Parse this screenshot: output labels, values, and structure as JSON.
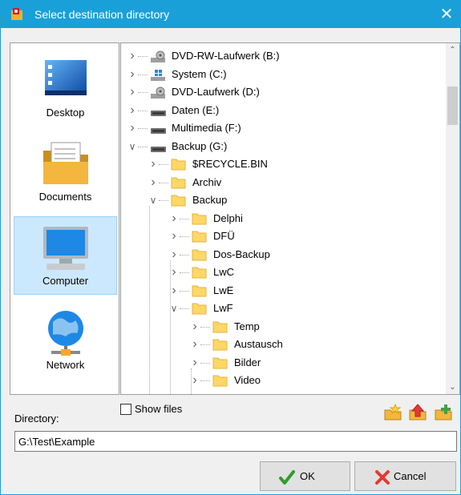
{
  "window": {
    "title": "Select destination directory",
    "titlebar_color": "#1aa0d8",
    "close_label": "✕"
  },
  "places": [
    {
      "label": "Desktop",
      "icon": "desktop-icon",
      "selected": false
    },
    {
      "label": "Documents",
      "icon": "documents-folder-icon",
      "selected": false
    },
    {
      "label": "Computer",
      "icon": "computer-icon",
      "selected": true
    },
    {
      "label": "Network",
      "icon": "network-globe-icon",
      "selected": false
    }
  ],
  "tree": {
    "nodes": [
      {
        "label": "DVD-RW-Laufwerk (B:)",
        "icon": "dvd-drive-icon",
        "expanded": false
      },
      {
        "label": "System (C:)",
        "icon": "windows-drive-icon",
        "expanded": false
      },
      {
        "label": "DVD-Laufwerk (D:)",
        "icon": "dvd-drive-icon",
        "expanded": false
      },
      {
        "label": "Daten (E:)",
        "icon": "hard-drive-icon",
        "expanded": false
      },
      {
        "label": "Multimedia (F:)",
        "icon": "hard-drive-icon",
        "expanded": false
      },
      {
        "label": "Backup (G:)",
        "icon": "hard-drive-icon",
        "expanded": true
      },
      {
        "label": "$RECYCLE.BIN",
        "icon": "folder-icon",
        "expanded": false
      },
      {
        "label": "Archiv",
        "icon": "folder-icon",
        "expanded": false
      },
      {
        "label": "Backup",
        "icon": "folder-icon",
        "expanded": true
      },
      {
        "label": "Delphi",
        "icon": "folder-icon",
        "expanded": false
      },
      {
        "label": "DFÜ",
        "icon": "folder-icon",
        "expanded": false
      },
      {
        "label": "Dos-Backup",
        "icon": "folder-icon",
        "expanded": false
      },
      {
        "label": "LwC",
        "icon": "folder-icon",
        "expanded": false
      },
      {
        "label": "LwE",
        "icon": "folder-icon",
        "expanded": false
      },
      {
        "label": "LwF",
        "icon": "folder-icon",
        "expanded": true
      },
      {
        "label": "Temp",
        "icon": "folder-icon",
        "expanded": false
      },
      {
        "label": "Austausch",
        "icon": "folder-icon",
        "expanded": false
      },
      {
        "label": "Bilder",
        "icon": "folder-icon",
        "expanded": false
      },
      {
        "label": "Video",
        "icon": "folder-icon",
        "expanded": false
      }
    ]
  },
  "directory": {
    "label": "Directory:",
    "value": "G:\\Test\\Example"
  },
  "show_files": {
    "label": "Show files",
    "checked": false
  },
  "toolbar": {
    "buttons": [
      "new-folder-star-icon",
      "folder-up-icon",
      "add-folder-icon"
    ]
  },
  "buttons": {
    "ok_label": "OK",
    "cancel_label": "Cancel"
  }
}
